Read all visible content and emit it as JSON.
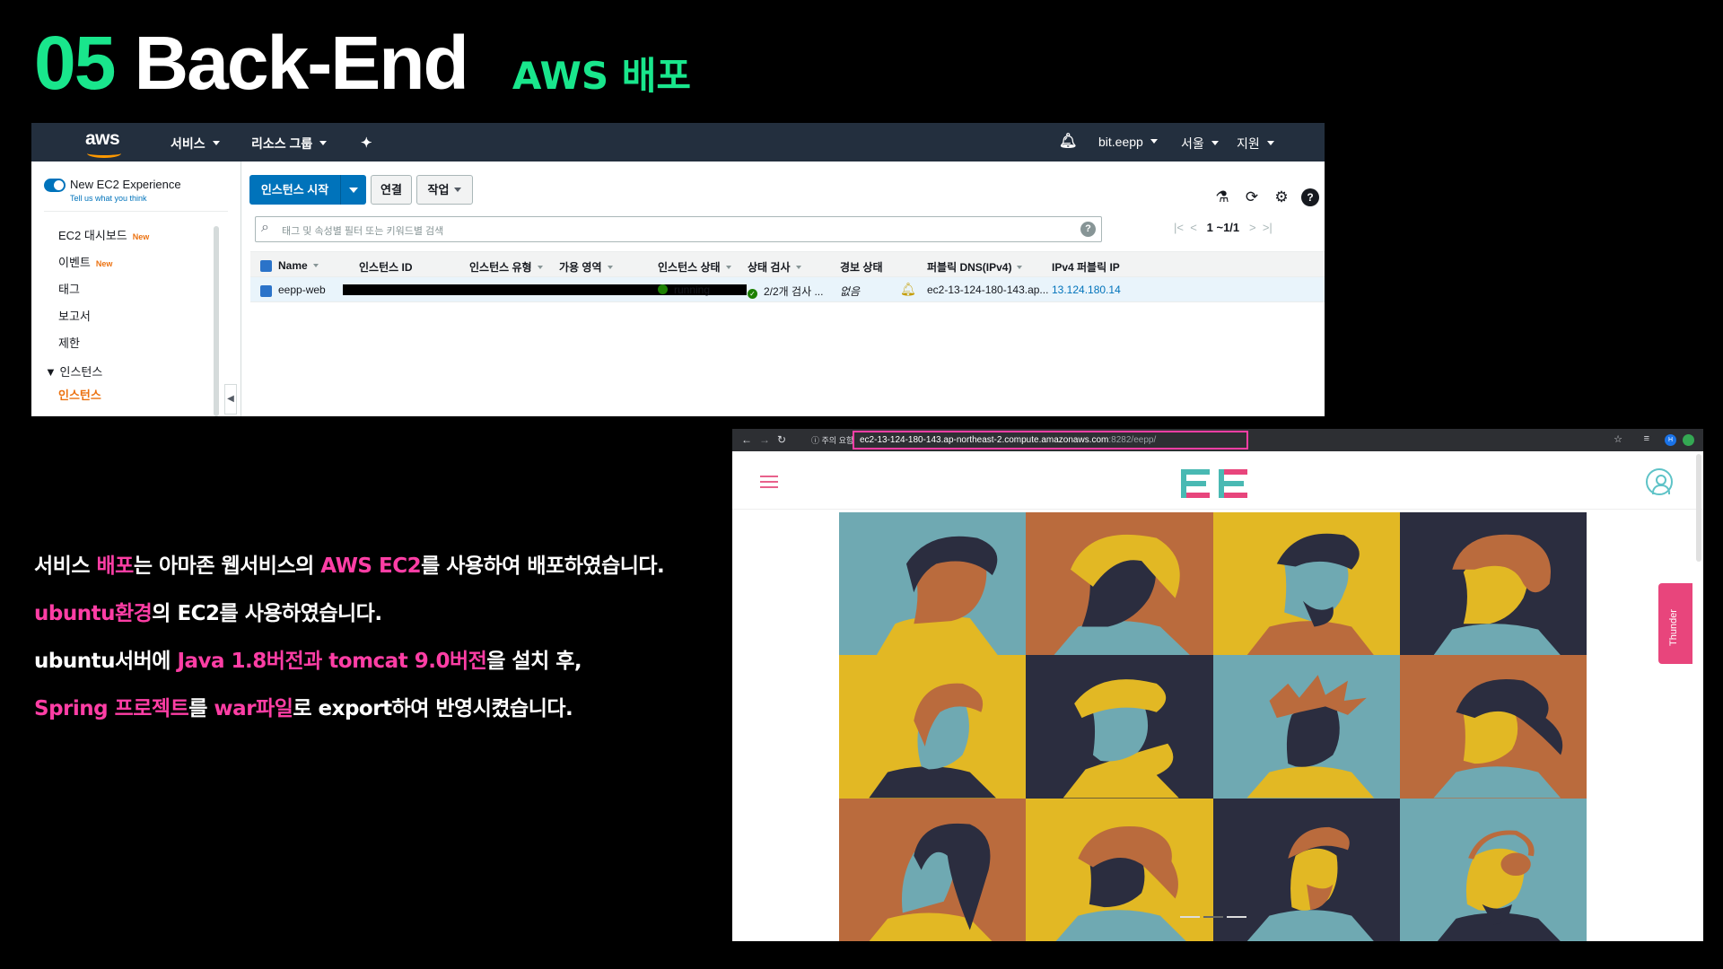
{
  "slide": {
    "number": "05",
    "title": "Back-End",
    "subtitle": "AWS 배포"
  },
  "aws_console": {
    "logo": "aws",
    "nav": {
      "services": "서비스",
      "resource_groups": "리소스 그룹",
      "account": "bit.eepp",
      "region": "서울",
      "support": "지원"
    },
    "sidebar": {
      "new_experience": "New EC2 Experience",
      "tell_us": "Tell us what you think",
      "new_badge": "New",
      "items": [
        "EC2 대시보드",
        "이벤트",
        "태그",
        "보고서",
        "제한"
      ],
      "group": "▼ 인스턴스",
      "active_item": "인스턴스"
    },
    "toolbar": {
      "launch": "인스턴스 시작",
      "connect": "연결",
      "actions": "작업"
    },
    "search_placeholder": "태그 및 속성별 필터 또는 키워드별 검색",
    "pagination": "1 ~1/1",
    "columns": [
      "Name",
      "인스턴스 ID",
      "인스턴스 유형",
      "가용 영역",
      "인스턴스 상태",
      "상태 검사",
      "경보 상태",
      "퍼블릭 DNS(IPv4)",
      "IPv4 퍼블릭 IP"
    ],
    "row": {
      "name": "eepp-web",
      "state": "running",
      "status_check": "2/2개 검사 ...",
      "alarm": "없음",
      "public_dns": "ec2-13-124-180-143.ap...",
      "public_ip": "13.124.180.14"
    },
    "colors": {
      "header": "#232f3e",
      "primary": "#0073bb",
      "accent": "#ec7211"
    }
  },
  "body_text": {
    "line1": {
      "a": "서비스 ",
      "b": "배포",
      "c": "는 아마존 웹서비스의 ",
      "d": "AWS EC2",
      "e": "를 사용하여 배포하였습니다."
    },
    "line2": {
      "a": "ubuntu환경",
      "b": "의 EC2를 사용하였습니다."
    },
    "line3": {
      "a": "ubuntu서버에 ",
      "b": "Java 1.8버전과 tomcat 9.0버전",
      "c": "을 설치 후,"
    },
    "line4": {
      "a": "Spring 프로젝트",
      "b": "를 ",
      "c": "war파일",
      "d": "로 export하여 반영시켰습니다."
    }
  },
  "browser": {
    "security_label": "주의 요함",
    "url_host": "ec2-13-124-180-143.ap-northeast-2.compute.amazonaws.com",
    "url_port_path": ":8282/eepp/",
    "profile_initial": "H",
    "side_tab": "Thunder",
    "icons": [
      "back-icon",
      "forward-icon",
      "reload-icon",
      "info-icon",
      "star-icon",
      "menu-icon",
      "user-icon"
    ],
    "colors": {
      "highlight": "#ff3ea5",
      "logo_teal": "#49b9b3",
      "logo_pink": "#e8457c"
    }
  },
  "colors": {
    "green": "#19e68c",
    "pink": "#ff3ea5",
    "background": "#000000"
  }
}
